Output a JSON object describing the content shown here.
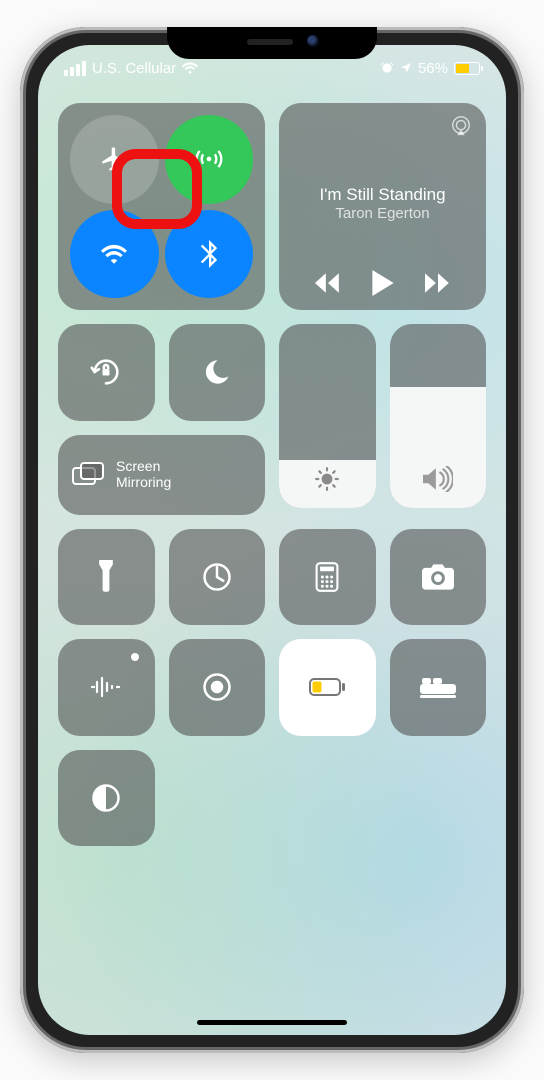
{
  "status": {
    "carrier": "U.S. Cellular",
    "battery_pct": "56%",
    "battery_color": "#ffcc00"
  },
  "media": {
    "song": "I'm Still Standing",
    "artist": "Taron Egerton"
  },
  "screen_mirroring": {
    "line1": "Screen",
    "line2": "Mirroring"
  },
  "connectivity": {
    "airplane": false,
    "cellular": true,
    "wifi": true,
    "bluetooth": true
  },
  "sliders": {
    "brightness_pct": 26,
    "volume_pct": 66
  },
  "low_power_active": true,
  "annotation": {
    "highlight_circle": true
  }
}
